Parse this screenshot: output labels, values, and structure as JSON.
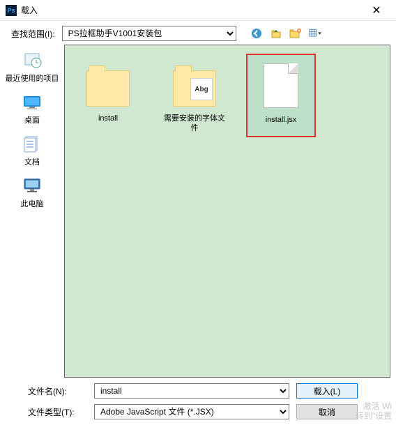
{
  "title": "载入",
  "lookIn": {
    "label": "查找范围(I):",
    "value": "PS拉框助手V1001安装包"
  },
  "places": {
    "recent": "最近使用的项目",
    "desktop": "桌面",
    "documents": "文档",
    "thispc": "此电脑"
  },
  "files": {
    "f1": "install",
    "f2": "需要安装的字体文件",
    "f3": "install.jsx"
  },
  "filename": {
    "label": "文件名(N):",
    "value": "install"
  },
  "filetype": {
    "label": "文件类型(T):",
    "value": "Adobe JavaScript 文件 (*.JSX)"
  },
  "buttons": {
    "load": "载入(L)",
    "cancel": "取消"
  },
  "watermark": {
    "l1": "激活 Wi",
    "l2": "转到\"设置"
  }
}
